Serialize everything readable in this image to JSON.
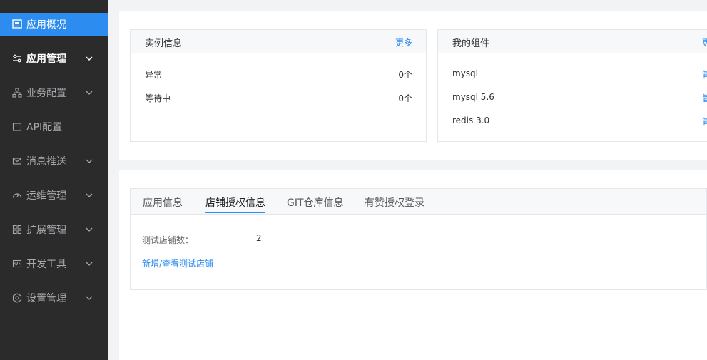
{
  "sidebar": {
    "items": [
      {
        "label": "应用概况",
        "icon": "dashboard-icon",
        "state": "active"
      },
      {
        "label": "应用管理",
        "icon": "sliders-icon",
        "state": "expanded"
      },
      {
        "label": "业务配置",
        "icon": "hierarchy-icon",
        "state": "collapsed"
      },
      {
        "label": "API配置",
        "icon": "window-icon",
        "state": "none"
      },
      {
        "label": "消息推送",
        "icon": "mail-icon",
        "state": "collapsed"
      },
      {
        "label": "运维管理",
        "icon": "gauge-icon",
        "state": "collapsed"
      },
      {
        "label": "扩展管理",
        "icon": "grid-icon",
        "state": "collapsed"
      },
      {
        "label": "开发工具",
        "icon": "code-icon",
        "state": "collapsed"
      },
      {
        "label": "设置管理",
        "icon": "hexagon-gear-icon",
        "state": "collapsed"
      }
    ]
  },
  "instance_card": {
    "title": "实例信息",
    "more": "更多",
    "rows": [
      {
        "label": "异常",
        "value": "0个"
      },
      {
        "label": "等待中",
        "value": "0个"
      }
    ]
  },
  "components_card": {
    "title": "我的组件",
    "more": "更",
    "rows": [
      {
        "label": "mysql",
        "action": "管"
      },
      {
        "label": "mysql 5.6",
        "action": "管"
      },
      {
        "label": "redis 3.0",
        "action": "管"
      }
    ]
  },
  "tabs": {
    "items": [
      "应用信息",
      "店铺授权信息",
      "GIT仓库信息",
      "有赞授权登录"
    ],
    "active_index": 1
  },
  "store_auth": {
    "test_store_count_label": "测试店铺数：",
    "test_store_count": "2",
    "add_view_link": "新增/查看测试店铺"
  },
  "colors": {
    "accent": "#2d8cf0",
    "sidebar_bg": "#2b2b2b"
  }
}
